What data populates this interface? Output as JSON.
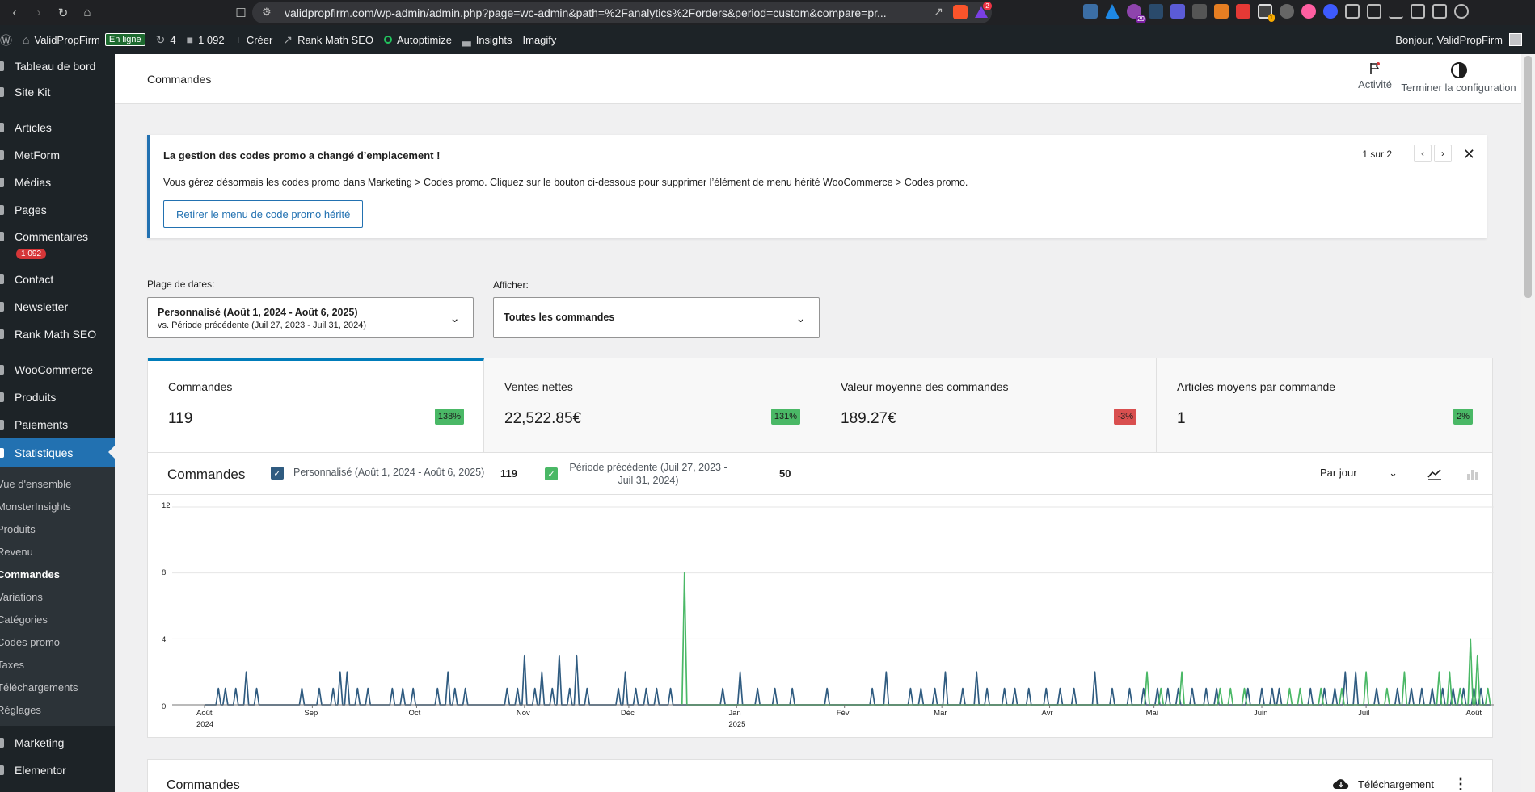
{
  "browser": {
    "url": "validpropfirm.com/wp-admin/admin.php?page=wc-admin&path=%2Fanalytics%2Forders&period=custom&compare=pr...",
    "brave_badge": "2",
    "ext_badge": "29",
    "ext_badge2": "1"
  },
  "adminbar": {
    "site_name": "ValidPropFirm",
    "online_badge": "En ligne",
    "updates": "4",
    "comments": "1 092",
    "create": "Créer",
    "rankmath": "Rank Math SEO",
    "autoptimize": "Autoptimize",
    "insights": "Insights",
    "imagify": "Imagify",
    "greeting": "Bonjour, ValidPropFirm"
  },
  "sidebar": {
    "items": [
      {
        "label": "Tableau de bord"
      },
      {
        "label": "Site Kit"
      },
      {
        "label": "Articles"
      },
      {
        "label": "MetForm"
      },
      {
        "label": "Médias"
      },
      {
        "label": "Pages"
      },
      {
        "label": "Commentaires"
      },
      {
        "label": "Contact"
      },
      {
        "label": "Newsletter"
      },
      {
        "label": "Rank Math SEO"
      },
      {
        "label": "WooCommerce"
      },
      {
        "label": "Produits"
      },
      {
        "label": "Paiements"
      },
      {
        "label": "Statistiques"
      },
      {
        "label": "Marketing"
      },
      {
        "label": "Elementor"
      }
    ],
    "comments_badge": "1 092",
    "submenu": [
      "Vue d'ensemble",
      "MonsterInsights",
      "Produits",
      "Revenu",
      "Commandes",
      "Variations",
      "Catégories",
      "Codes promo",
      "Taxes",
      "Téléchargements",
      "Réglages"
    ]
  },
  "header": {
    "title": "Commandes",
    "activity": "Activité",
    "finish_setup": "Terminer la configuration"
  },
  "notice": {
    "title": "La gestion des codes promo a changé d’emplacement !",
    "body": "Vous gérez désormais les codes promo dans Marketing > Codes promo. Cliquez sur le bouton ci-dessous pour supprimer l’élément de menu hérité WooCommerce > Codes promo.",
    "button": "Retirer le menu de code promo hérité",
    "pager": "1 sur 2"
  },
  "filters": {
    "date_label": "Plage de dates:",
    "date_value": "Personnalisé (Août 1, 2024 - Août 6, 2025)",
    "date_compare": "vs. Période précédente (Juil 27, 2023 - Juil 31, 2024)",
    "show_label": "Afficher:",
    "show_value": "Toutes les commandes"
  },
  "kpis": [
    {
      "label": "Commandes",
      "value": "119",
      "delta": "138%",
      "trend": "up"
    },
    {
      "label": "Ventes nettes",
      "value": "22,522.85€",
      "delta": "131%",
      "trend": "up"
    },
    {
      "label": "Valeur moyenne des commandes",
      "value": "189.27€",
      "delta": "-3%",
      "trend": "down"
    },
    {
      "label": "Articles moyens par commande",
      "value": "1",
      "delta": "2%",
      "trend": "up"
    }
  ],
  "chart": {
    "title": "Commandes",
    "legend_current": "Personnalisé (Août 1, 2024 - Août 6, 2025)",
    "legend_current_total": "119",
    "legend_previous": "Période précédente (Juil 27, 2023 - Juil 31, 2024)",
    "legend_previous_total": "50",
    "interval": "Par jour"
  },
  "chart_data": {
    "type": "line",
    "ylim": [
      0,
      12
    ],
    "y_ticks": [
      "12",
      "8",
      "4",
      "0"
    ],
    "x_ticks": [
      {
        "month": "Août",
        "year": "2024"
      },
      {
        "month": "Sep",
        "year": ""
      },
      {
        "month": "Oct",
        "year": ""
      },
      {
        "month": "Nov",
        "year": ""
      },
      {
        "month": "Déc",
        "year": ""
      },
      {
        "month": "Jan",
        "year": "2025"
      },
      {
        "month": "Fév",
        "year": ""
      },
      {
        "month": "Mar",
        "year": ""
      },
      {
        "month": "Avr",
        "year": ""
      },
      {
        "month": "Mai",
        "year": ""
      },
      {
        "month": "Juin",
        "year": ""
      },
      {
        "month": "Juil",
        "year": ""
      },
      {
        "month": "Août",
        "year": ""
      }
    ],
    "series": [
      {
        "name": "Personnalisé (Août 1, 2024 - Août 6, 2025)",
        "color": "#2f5b80",
        "spikes": [
          [
            "2024-08-05",
            1
          ],
          [
            "2024-08-07",
            1
          ],
          [
            "2024-08-10",
            1
          ],
          [
            "2024-08-13",
            2
          ],
          [
            "2024-08-16",
            1
          ],
          [
            "2024-08-29",
            1
          ],
          [
            "2024-09-03",
            1
          ],
          [
            "2024-09-07",
            1
          ],
          [
            "2024-09-09",
            2
          ],
          [
            "2024-09-11",
            2
          ],
          [
            "2024-09-14",
            1
          ],
          [
            "2024-09-17",
            1
          ],
          [
            "2024-09-24",
            1
          ],
          [
            "2024-09-27",
            1
          ],
          [
            "2024-09-30",
            1
          ],
          [
            "2024-10-07",
            1
          ],
          [
            "2024-10-10",
            2
          ],
          [
            "2024-10-12",
            1
          ],
          [
            "2024-10-15",
            1
          ],
          [
            "2024-10-27",
            1
          ],
          [
            "2024-10-30",
            1
          ],
          [
            "2024-11-01",
            3
          ],
          [
            "2024-11-04",
            1
          ],
          [
            "2024-11-06",
            2
          ],
          [
            "2024-11-09",
            1
          ],
          [
            "2024-11-11",
            3
          ],
          [
            "2024-11-14",
            1
          ],
          [
            "2024-11-16",
            3
          ],
          [
            "2024-11-19",
            1
          ],
          [
            "2024-11-28",
            1
          ],
          [
            "2024-11-30",
            2
          ],
          [
            "2024-12-03",
            1
          ],
          [
            "2024-12-06",
            1
          ],
          [
            "2024-12-09",
            1
          ],
          [
            "2024-12-13",
            1
          ],
          [
            "2024-12-28",
            1
          ],
          [
            "2025-01-02",
            2
          ],
          [
            "2025-01-07",
            1
          ],
          [
            "2025-01-12",
            1
          ],
          [
            "2025-01-17",
            1
          ],
          [
            "2025-01-27",
            1
          ],
          [
            "2025-02-09",
            1
          ],
          [
            "2025-02-13",
            2
          ],
          [
            "2025-02-20",
            1
          ],
          [
            "2025-02-23",
            1
          ],
          [
            "2025-02-27",
            1
          ],
          [
            "2025-03-02",
            2
          ],
          [
            "2025-03-07",
            1
          ],
          [
            "2025-03-11",
            2
          ],
          [
            "2025-03-14",
            1
          ],
          [
            "2025-03-19",
            1
          ],
          [
            "2025-03-22",
            1
          ],
          [
            "2025-03-26",
            1
          ],
          [
            "2025-03-31",
            1
          ],
          [
            "2025-04-04",
            1
          ],
          [
            "2025-04-08",
            1
          ],
          [
            "2025-04-14",
            2
          ],
          [
            "2025-04-19",
            1
          ],
          [
            "2025-04-24",
            1
          ],
          [
            "2025-04-28",
            1
          ],
          [
            "2025-05-02",
            1
          ],
          [
            "2025-05-05",
            1
          ],
          [
            "2025-05-08",
            1
          ],
          [
            "2025-05-12",
            1
          ],
          [
            "2025-05-16",
            1
          ],
          [
            "2025-05-19",
            1
          ],
          [
            "2025-05-28",
            1
          ],
          [
            "2025-06-01",
            1
          ],
          [
            "2025-06-04",
            1
          ],
          [
            "2025-06-06",
            1
          ],
          [
            "2025-06-15",
            1
          ],
          [
            "2025-06-19",
            1
          ],
          [
            "2025-06-22",
            1
          ],
          [
            "2025-06-25",
            2
          ],
          [
            "2025-06-28",
            2
          ],
          [
            "2025-07-04",
            1
          ],
          [
            "2025-07-10",
            1
          ],
          [
            "2025-07-14",
            1
          ],
          [
            "2025-07-17",
            1
          ],
          [
            "2025-07-20",
            1
          ],
          [
            "2025-07-23",
            1
          ],
          [
            "2025-07-26",
            1
          ],
          [
            "2025-07-29",
            1
          ],
          [
            "2025-08-01",
            1
          ],
          [
            "2025-08-03",
            1
          ]
        ]
      },
      {
        "name": "Période précédente (Juil 27, 2023 - Juil 31, 2024)",
        "color": "#4ab866",
        "spikes": [
          [
            "2024-12-17",
            8
          ],
          [
            "2025-04-29",
            2
          ],
          [
            "2025-05-03",
            1
          ],
          [
            "2025-05-09",
            2
          ],
          [
            "2025-05-20",
            1
          ],
          [
            "2025-05-23",
            1
          ],
          [
            "2025-05-27",
            1
          ],
          [
            "2025-06-09",
            1
          ],
          [
            "2025-06-12",
            1
          ],
          [
            "2025-06-18",
            1
          ],
          [
            "2025-06-24",
            1
          ],
          [
            "2025-07-01",
            2
          ],
          [
            "2025-07-07",
            1
          ],
          [
            "2025-07-12",
            2
          ],
          [
            "2025-07-22",
            2
          ],
          [
            "2025-07-25",
            2
          ],
          [
            "2025-07-28",
            1
          ],
          [
            "2025-07-31",
            4
          ],
          [
            "2025-08-02",
            3
          ],
          [
            "2025-08-05",
            1
          ]
        ]
      }
    ]
  },
  "orders_table": {
    "title": "Commandes",
    "download": "Téléchargement"
  }
}
